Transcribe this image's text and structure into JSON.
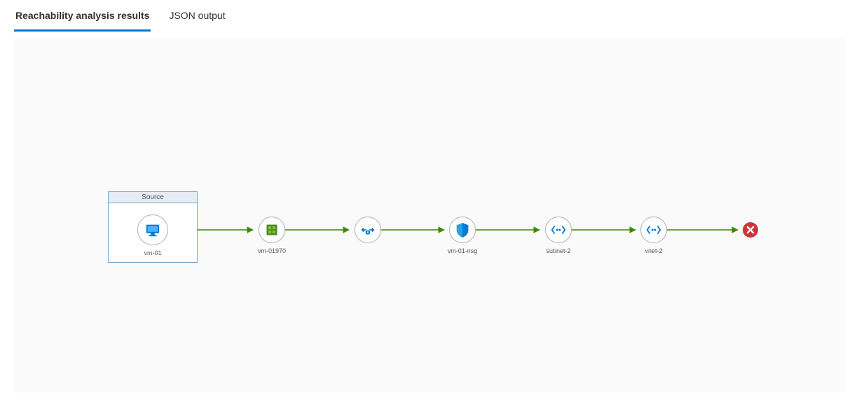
{
  "tabs": [
    {
      "id": "results",
      "label": "Reachability analysis results",
      "active": true
    },
    {
      "id": "json",
      "label": "JSON output",
      "active": false
    }
  ],
  "source_header": "Source",
  "nodes": {
    "vm": {
      "label": "vm-01"
    },
    "nic": {
      "label": "vm-01970"
    },
    "ipconfig": {
      "label": ""
    },
    "nsg": {
      "label": "vm-01-nsg"
    },
    "subnet": {
      "label": "subnet-2"
    },
    "vnet": {
      "label": "vnet-2"
    }
  },
  "colors": {
    "arrow": "#3a8a00",
    "error": "#d13438",
    "accent": "#0078d4"
  }
}
